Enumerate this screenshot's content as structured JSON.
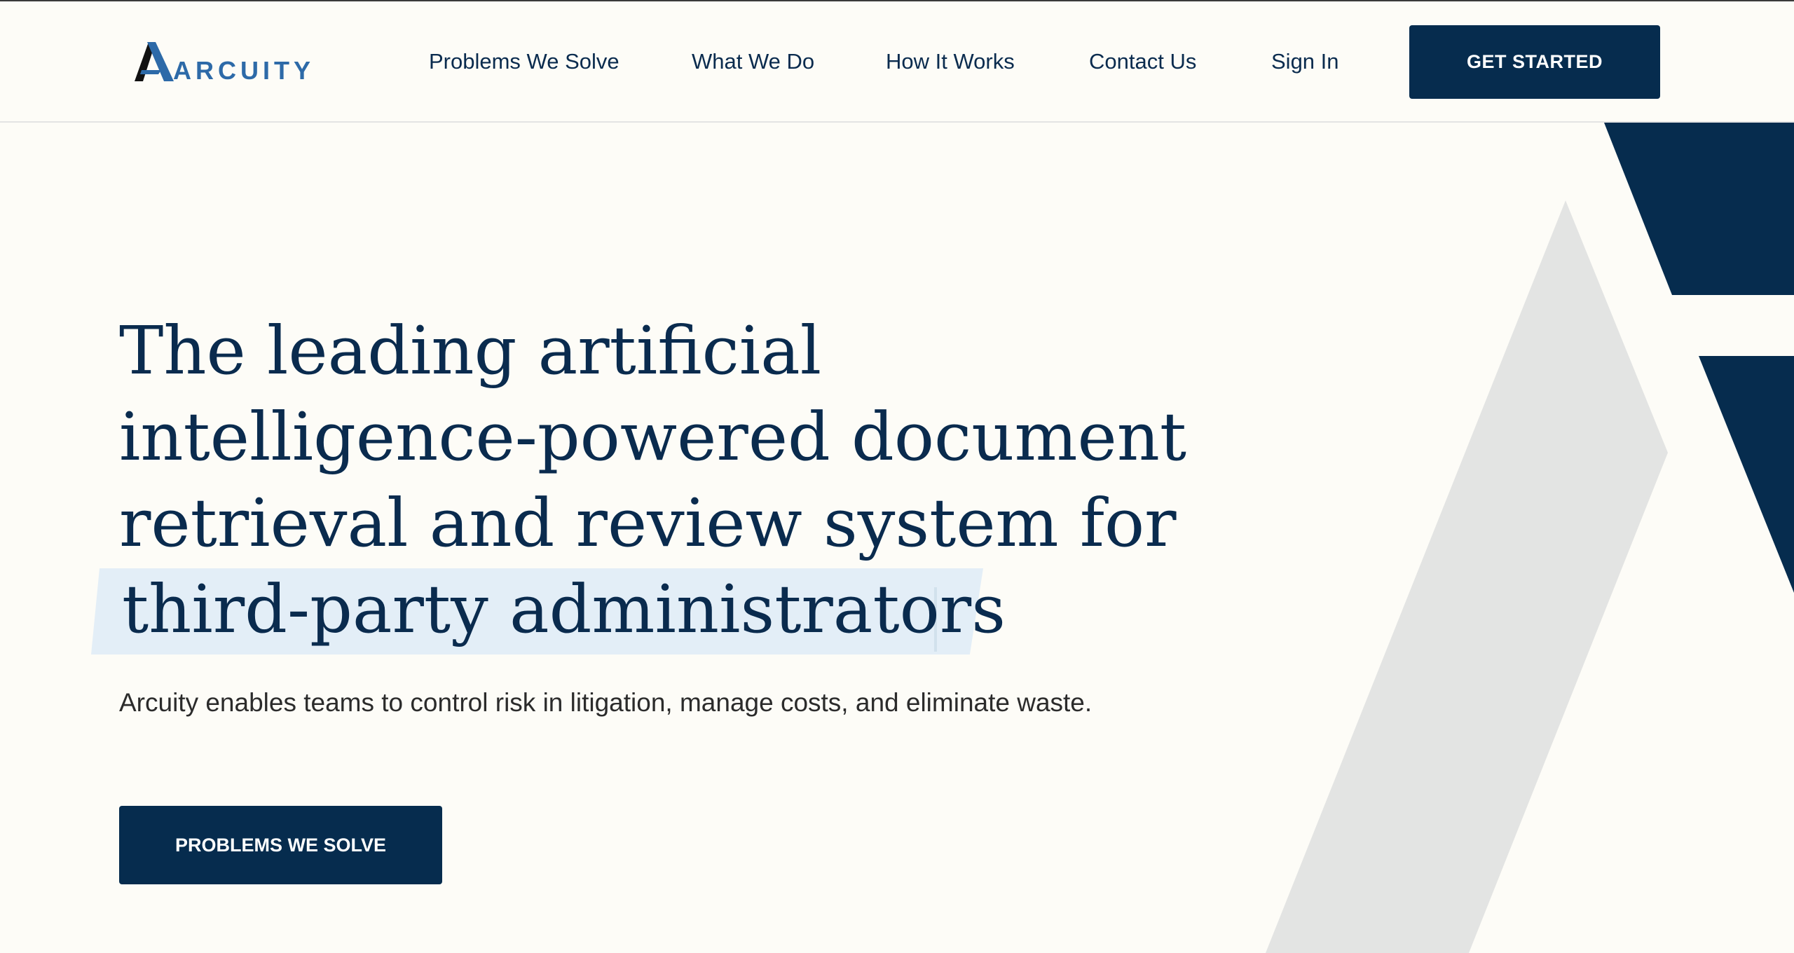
{
  "header": {
    "logo_text": "ARCUITY",
    "nav": [
      {
        "label": "Problems We Solve"
      },
      {
        "label": "What We Do"
      },
      {
        "label": "How It Works"
      },
      {
        "label": "Contact Us"
      },
      {
        "label": "Sign In"
      }
    ],
    "cta_label": "GET STARTED"
  },
  "hero": {
    "title_lines": [
      "The leading artificial",
      "intelligence-powered document",
      "retrieval and review system for",
      "third-party administrators"
    ],
    "subtitle": "Arcuity enables teams to control risk in litigation, manage costs, and eliminate waste.",
    "cta_label": "PROBLEMS WE SOLVE"
  },
  "colors": {
    "navy": "#062c4e",
    "text_navy": "#0a2b4e",
    "logo_blue": "#2d6aa8",
    "highlight": "#e3eef7",
    "background": "#fdfcf7",
    "deco_grey": "#e3e4e3"
  }
}
